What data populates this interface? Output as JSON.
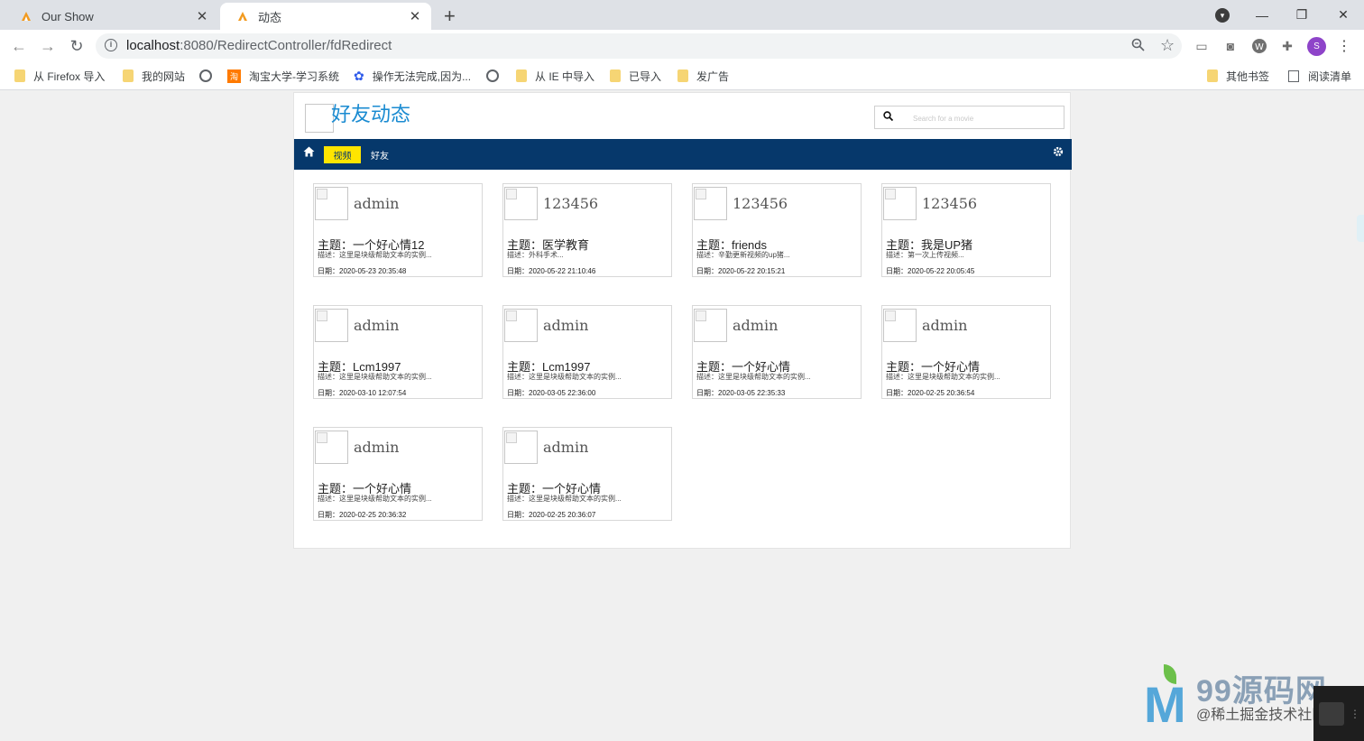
{
  "browser": {
    "tabs": [
      {
        "title": "Our Show",
        "active": false
      },
      {
        "title": "动态",
        "active": true
      }
    ],
    "url_host": "localhost",
    "url_path": ":8080/RedirectController/fdRedirect",
    "avatar_letter": "S",
    "bookmarks": [
      {
        "label": "从 Firefox 导入",
        "icon": "folder-icon"
      },
      {
        "label": "我的网站",
        "icon": "folder-icon"
      },
      {
        "label": "",
        "icon": "globe-icon"
      },
      {
        "label": "淘宝大学-学习系统",
        "icon": "taobao-icon"
      },
      {
        "label": "操作无法完成,因为...",
        "icon": "baidu-paw-icon"
      },
      {
        "label": "",
        "icon": "globe-icon"
      },
      {
        "label": "从 IE 中导入",
        "icon": "folder-icon"
      },
      {
        "label": "已导入",
        "icon": "folder-icon"
      },
      {
        "label": "发广告",
        "icon": "folder-icon"
      }
    ],
    "bookmarks_right": [
      {
        "label": "其他书签",
        "icon": "folder-icon"
      },
      {
        "label": "阅读清单",
        "icon": "reading-list-icon"
      }
    ]
  },
  "site": {
    "title": "好友动态",
    "search_placeholder": "Search for a movie",
    "nav": {
      "video": "视频",
      "friends": "好友"
    },
    "colors": {
      "navbar": "#06386b",
      "active_nav": "#ffe500",
      "title": "#1a8bd1"
    }
  },
  "cards": [
    {
      "user": "admin",
      "subject": "主题：一个好心情12",
      "desc": "描述：这里是块级帮助文本的实例...",
      "date": "日期：2020-05-23 20:35:48"
    },
    {
      "user": "123456",
      "subject": "主题：医学教育",
      "desc": "描述：外科手术...",
      "date": "日期：2020-05-22 21:10:46"
    },
    {
      "user": "123456",
      "subject": "主题：friends",
      "desc": "描述：辛勤更新视频的up猪...",
      "date": "日期：2020-05-22 20:15:21"
    },
    {
      "user": "123456",
      "subject": "主题：我是UP猪",
      "desc": "描述：第一次上传视频...",
      "date": "日期：2020-05-22 20:05:45"
    },
    {
      "user": "admin",
      "subject": "主题：Lcm1997",
      "desc": "描述：这里是块级帮助文本的实例...",
      "date": "日期：2020-03-10 12:07:54"
    },
    {
      "user": "admin",
      "subject": "主题：Lcm1997",
      "desc": "描述：这里是块级帮助文本的实例...",
      "date": "日期：2020-03-05 22:36:00"
    },
    {
      "user": "admin",
      "subject": "主题：一个好心情",
      "desc": "描述：这里是块级帮助文本的实例...",
      "date": "日期：2020-03-05 22:35:33"
    },
    {
      "user": "admin",
      "subject": "主题：一个好心情",
      "desc": "描述：这里是块级帮助文本的实例...",
      "date": "日期：2020-02-25 20:36:54"
    },
    {
      "user": "admin",
      "subject": "主题：一个好心情",
      "desc": "描述：这里是块级帮助文本的实例...",
      "date": "日期：2020-02-25 20:36:32"
    },
    {
      "user": "admin",
      "subject": "主题：一个好心情",
      "desc": "描述：这里是块级帮助文本的实例...",
      "date": "日期：2020-02-25 20:36:07"
    }
  ],
  "watermark": {
    "logo_text": "99源码网",
    "sub_text": "@稀土掘金技术社区"
  }
}
